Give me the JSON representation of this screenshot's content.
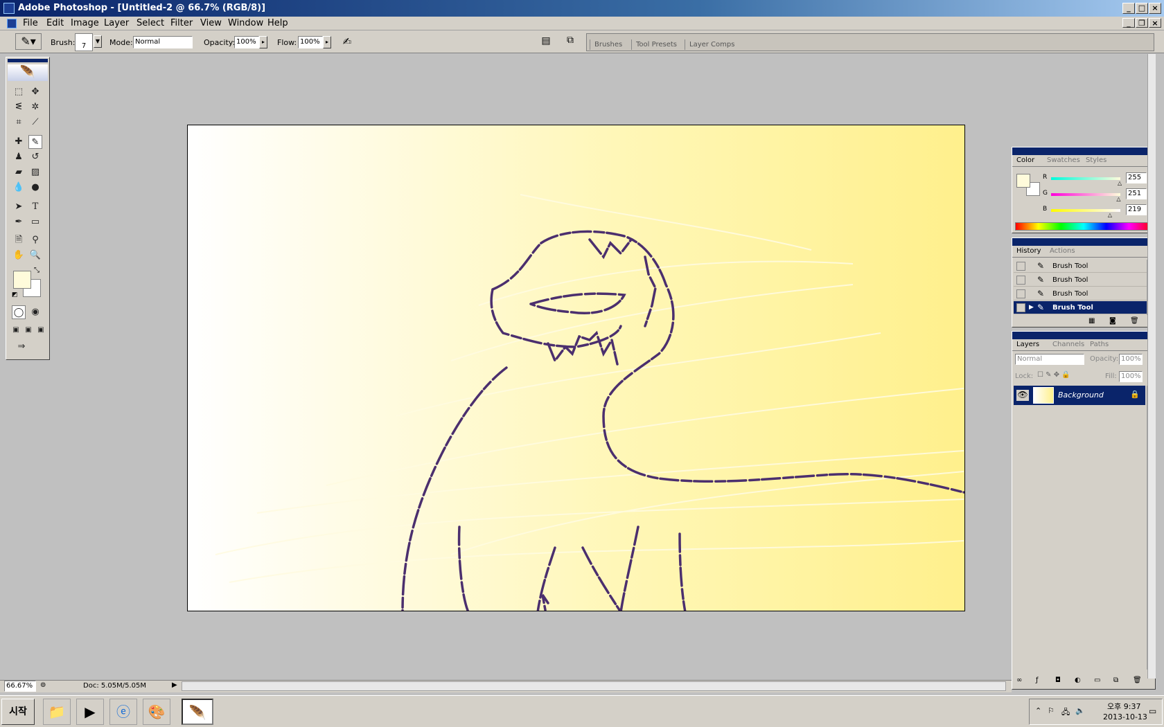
{
  "window": {
    "title": "Adobe Photoshop - [Untitled-2 @ 66.7% (RGB/8)]"
  },
  "menu": [
    "File",
    "Edit",
    "Image",
    "Layer",
    "Select",
    "Filter",
    "View",
    "Window",
    "Help"
  ],
  "options": {
    "brush_label": "Brush:",
    "brush_size": "7",
    "mode_label": "Mode:",
    "mode_value": "Normal",
    "opacity_label": "Opacity:",
    "opacity_value": "100%",
    "flow_label": "Flow:",
    "flow_value": "100%"
  },
  "palette_well": {
    "tabs": [
      "Brushes",
      "Tool Presets",
      "Layer Comps"
    ]
  },
  "colors": {
    "foreground": "#fffbdb",
    "background": "#ffffff",
    "sketch_stroke": "#4b2f6e"
  },
  "color_panel": {
    "tabs": [
      "Color",
      "Swatches",
      "Styles"
    ],
    "channels": [
      {
        "label": "R",
        "value": "255",
        "level": 1.0
      },
      {
        "label": "G",
        "value": "251",
        "level": 0.984
      },
      {
        "label": "B",
        "value": "219",
        "level": 0.859
      }
    ]
  },
  "history_panel": {
    "tabs": [
      "History",
      "Actions"
    ],
    "items": [
      "Brush Tool",
      "Brush Tool",
      "Brush Tool",
      "Brush Tool"
    ],
    "selected_index": 3
  },
  "layers_panel": {
    "tabs": [
      "Layers",
      "Channels",
      "Paths"
    ],
    "blend_mode": "Normal",
    "opacity_label": "Opacity:",
    "opacity_value": "100%",
    "lock_label": "Lock:",
    "fill_label": "Fill:",
    "fill_value": "100%",
    "layers": [
      {
        "name": "Background",
        "visible": true,
        "locked": true
      }
    ]
  },
  "status": {
    "zoom": "66.67%",
    "doc_info": "Doc: 5.05M/5.05M"
  },
  "taskbar": {
    "start_label": "시작",
    "time": "오후 9:37",
    "date": "2013-10-13"
  }
}
